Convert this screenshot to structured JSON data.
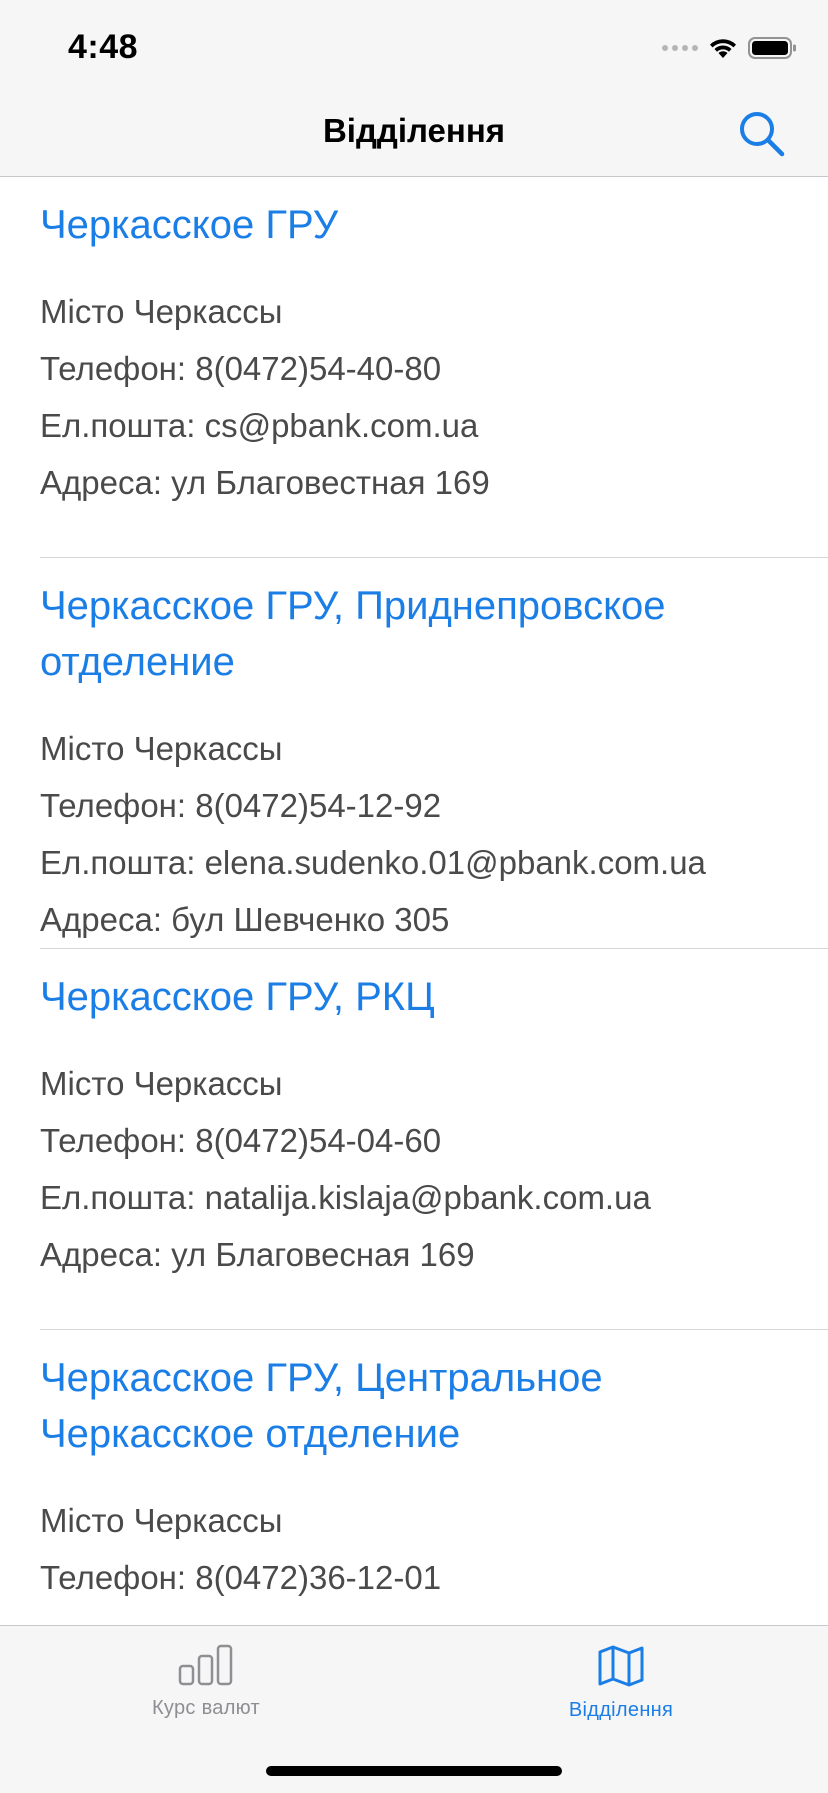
{
  "status_bar": {
    "time": "4:48"
  },
  "nav": {
    "title": "Відділення",
    "search_icon": "search-icon"
  },
  "branches": [
    {
      "name": "Черкасское ГРУ",
      "city": "Місто Черкассы",
      "phone": "Телефон: 8(0472)54-40-80",
      "email": "Ел.пошта: cs@pbank.com.ua",
      "address": "Адреса: ул Благовестная 169"
    },
    {
      "name": "Черкасское ГРУ, Приднепровское отделение",
      "city": "Місто Черкассы",
      "phone": "Телефон: 8(0472)54-12-92",
      "email": "Ел.пошта: elena.sudenko.01@pbank.com.ua",
      "address": "Адреса: бул Шевченко 305"
    },
    {
      "name": "Черкасское ГРУ, РКЦ",
      "city": "Місто Черкассы",
      "phone": "Телефон: 8(0472)54-04-60",
      "email": "Ел.пошта: natalija.kislaja@pbank.com.ua",
      "address": "Адреса: ул Благовесная 169"
    },
    {
      "name": "Черкасское ГРУ, Центральное Черкасское отделение",
      "city": "Місто Черкассы",
      "phone": "Телефон: 8(0472)36-12-01"
    }
  ],
  "tab_bar": {
    "tabs": [
      {
        "label": "Курс валют",
        "icon": "bar-chart-icon",
        "selected": false
      },
      {
        "label": "Відділення",
        "icon": "map-icon",
        "selected": true
      }
    ]
  },
  "colors": {
    "accent": "#1a7ee6",
    "inactive_tab": "#8e8e93",
    "info_text": "#4a4a4a",
    "bar_background": "#f6f6f6"
  }
}
